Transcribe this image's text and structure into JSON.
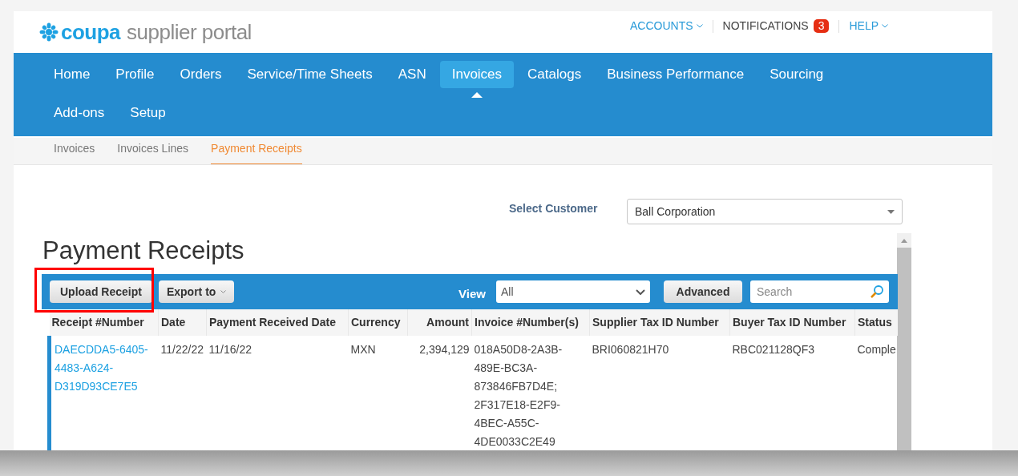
{
  "logo": {
    "brand": "coupa",
    "product": "supplier portal"
  },
  "top_links": [
    {
      "label": "ACCOUNTS",
      "kind": "dropdown"
    },
    {
      "label": "NOTIFICATIONS",
      "kind": "badge",
      "badge": "3"
    },
    {
      "label": "HELP",
      "kind": "dropdown"
    }
  ],
  "nav": [
    {
      "label": "Home",
      "selected": false
    },
    {
      "label": "Profile",
      "selected": false
    },
    {
      "label": "Orders",
      "selected": false
    },
    {
      "label": "Service/Time Sheets",
      "selected": false
    },
    {
      "label": "ASN",
      "selected": false
    },
    {
      "label": "Invoices",
      "selected": true
    },
    {
      "label": "Catalogs",
      "selected": false
    },
    {
      "label": "Business Performance",
      "selected": false
    },
    {
      "label": "Sourcing",
      "selected": false
    },
    {
      "label": "Add-ons",
      "selected": false
    },
    {
      "label": "Setup",
      "selected": false
    }
  ],
  "subnav": [
    {
      "label": "Invoices",
      "selected": false
    },
    {
      "label": "Invoices Lines",
      "selected": false
    },
    {
      "label": "Payment Receipts",
      "selected": true
    }
  ],
  "customer_select": {
    "label": "Select Customer",
    "value": "Ball Corporation"
  },
  "page_title": "Payment Receipts",
  "toolbar": {
    "upload_button": "Upload Receipt",
    "export_button": "Export to",
    "view_label": "View",
    "view_value": "All",
    "advanced_button": "Advanced",
    "search": {
      "placeholder": "Search"
    }
  },
  "table": {
    "columns": [
      "Receipt #Number",
      "Date",
      "Payment Received Date",
      "Currency",
      "Amount",
      "Invoice #Number(s)",
      "Supplier Tax ID Number",
      "Buyer Tax ID Number",
      "Status"
    ],
    "rows": [
      {
        "cells": [
          "DAECDDA5-6405-4483-A624-D319D93CE7E5",
          "11/22/22",
          "11/16/22",
          "MXN",
          "2,394,129",
          "018A50D8-2A3B-489E-BC3A-873846FB7D4E; 2F317E18-E2F9-4BEC-A55C-4DE0033C2E49",
          "BRI060821H70",
          "RBC021128QF3",
          "Comple"
        ]
      }
    ]
  }
}
